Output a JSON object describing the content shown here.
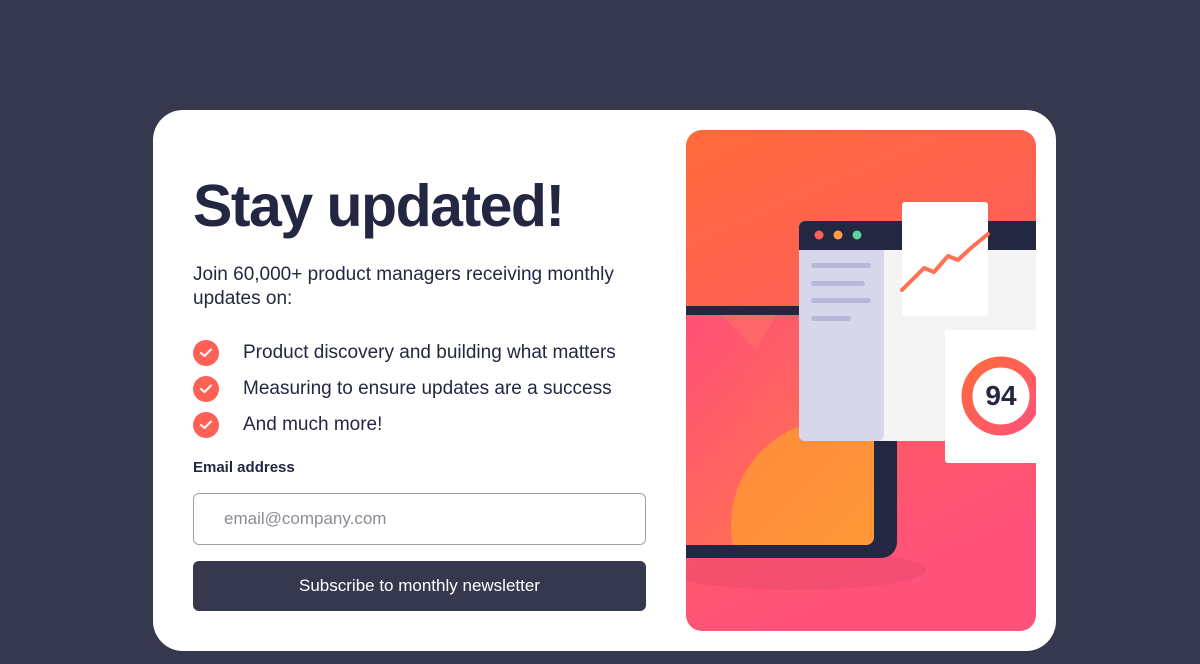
{
  "signup": {
    "title": "Stay updated!",
    "intro": "Join 60,000+ product managers receiving monthly updates on:",
    "features": [
      "Product discovery and building what matters",
      "Measuring to ensure updates are a success",
      "And much more!"
    ],
    "email_label": "Email address",
    "email_placeholder": "email@company.com",
    "email_value": "",
    "subscribe_label": "Subscribe to monthly newsletter"
  },
  "illustration": {
    "score": "94"
  },
  "colors": {
    "page_background": "#36384e",
    "card_background": "#ffffff",
    "text_dark": "#242742",
    "accent_tomato": "#ff6155",
    "button_background": "#36384e"
  },
  "icons": {
    "feature_bullet": "check-circle-icon"
  }
}
